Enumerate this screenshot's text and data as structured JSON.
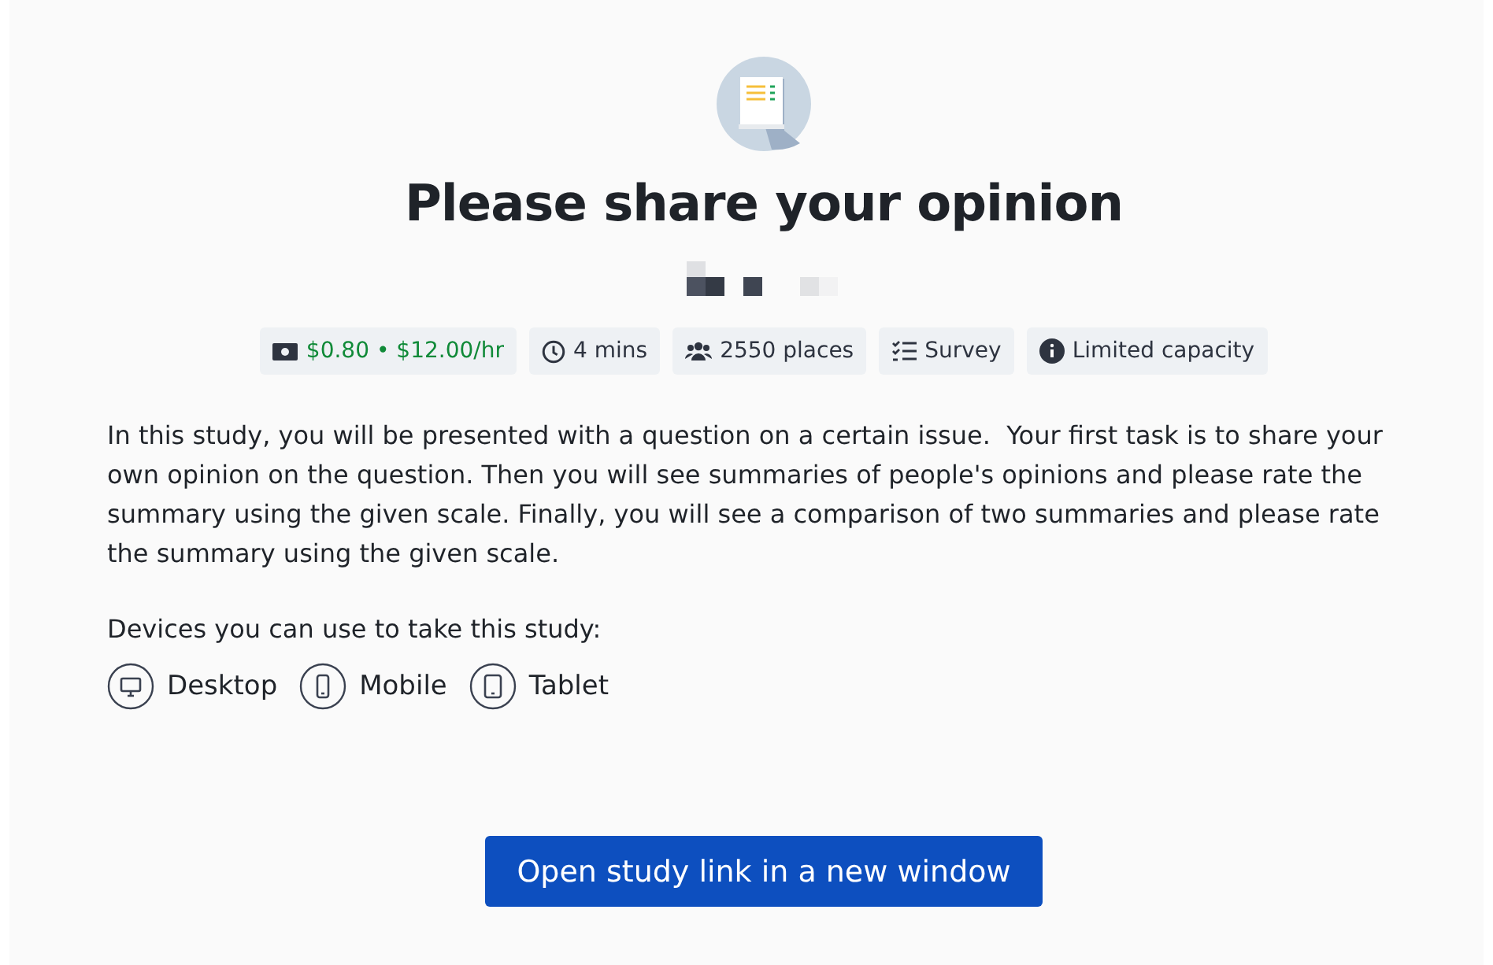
{
  "study": {
    "title": "Please share your opinion"
  },
  "tags": [
    {
      "kind": "reward",
      "label": "$0.80 • $12.00/hr"
    },
    {
      "kind": "time",
      "label": "4 mins"
    },
    {
      "kind": "places",
      "label": "2550 places"
    },
    {
      "kind": "type",
      "label": "Survey"
    },
    {
      "kind": "info",
      "label": "Limited capacity"
    }
  ],
  "description": "In this study, you will be presented with a question on a certain issue.  Your first task is to share your own opinion on the question. Then you will see summaries of people's opinions and please rate the summary using the given scale. Finally, you will see a comparison of two summaries and please rate the summary using the given scale.",
  "devices": {
    "heading": "Devices you can use to take this study:",
    "items": [
      {
        "kind": "desktop",
        "label": "Desktop"
      },
      {
        "kind": "mobile",
        "label": "Mobile"
      },
      {
        "kind": "tablet",
        "label": "Tablet"
      }
    ]
  },
  "button": {
    "label": "Open study link in a new window"
  }
}
